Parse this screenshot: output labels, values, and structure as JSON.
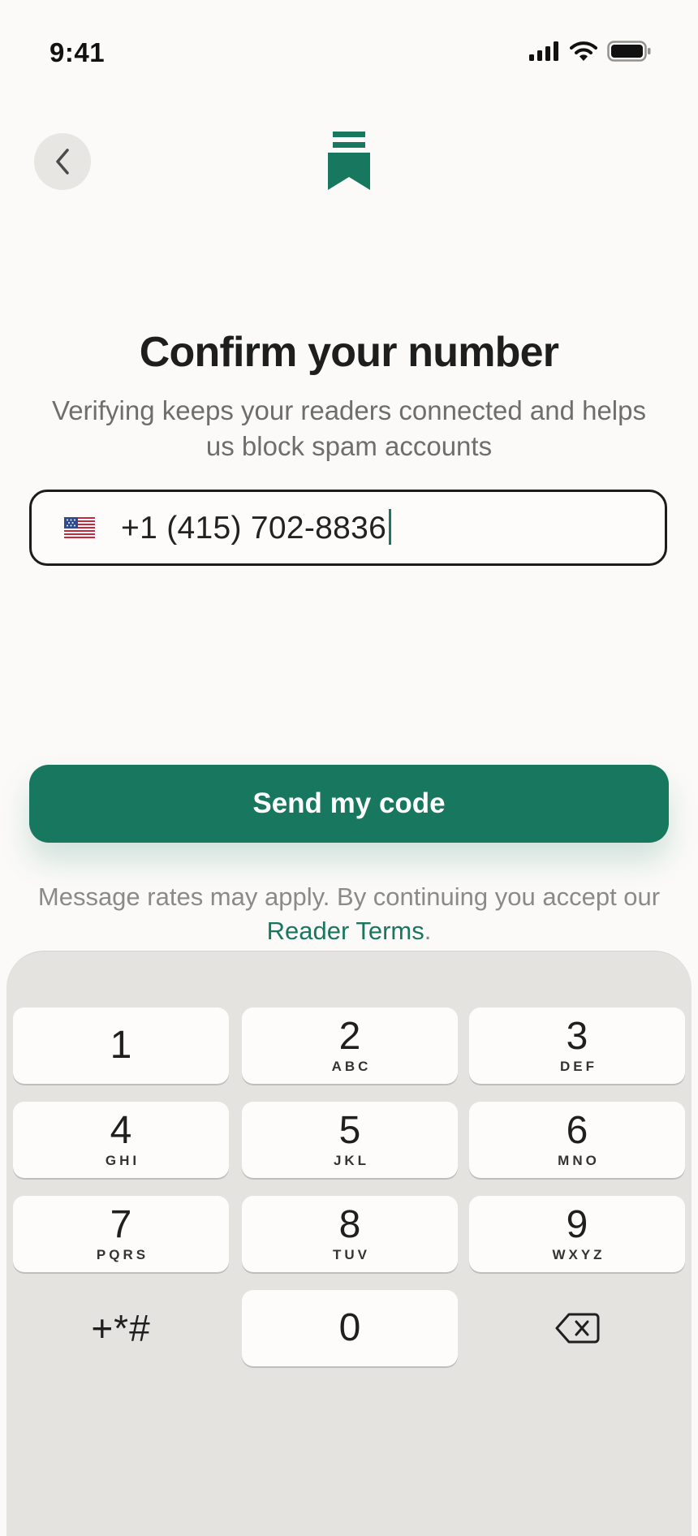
{
  "status_bar": {
    "time": "9:41",
    "icons": [
      "cellular-signal-icon",
      "wifi-icon",
      "battery-icon"
    ]
  },
  "header": {
    "back_icon": "chevron-left-icon",
    "logo_icon": "bookmark-logo-icon"
  },
  "main": {
    "title": "Confirm your number",
    "subtitle": "Verifying keeps your readers connected and helps us block spam accounts",
    "phone_input": {
      "country_flag": "us-flag-icon",
      "value": "+1 (415) 702-8836"
    },
    "send_button_label": "Send my code",
    "legal": {
      "text_before": "Message rates may apply. By continuing you accept our ",
      "link_text": "Reader Terms",
      "text_after": "."
    }
  },
  "keypad": {
    "keys": [
      {
        "digit": "1",
        "letters": ""
      },
      {
        "digit": "2",
        "letters": "ABC"
      },
      {
        "digit": "3",
        "letters": "DEF"
      },
      {
        "digit": "4",
        "letters": "GHI"
      },
      {
        "digit": "5",
        "letters": "JKL"
      },
      {
        "digit": "6",
        "letters": "MNO"
      },
      {
        "digit": "7",
        "letters": "PQRS"
      },
      {
        "digit": "8",
        "letters": "TUV"
      },
      {
        "digit": "9",
        "letters": "WXYZ"
      },
      {
        "digit": "0",
        "letters": ""
      }
    ],
    "symbols_label": "+*#",
    "delete_icon": "backspace-icon"
  },
  "colors": {
    "accent": "#18775F",
    "background": "#FBFAF8",
    "keyboard_background": "#E5E3DF"
  }
}
